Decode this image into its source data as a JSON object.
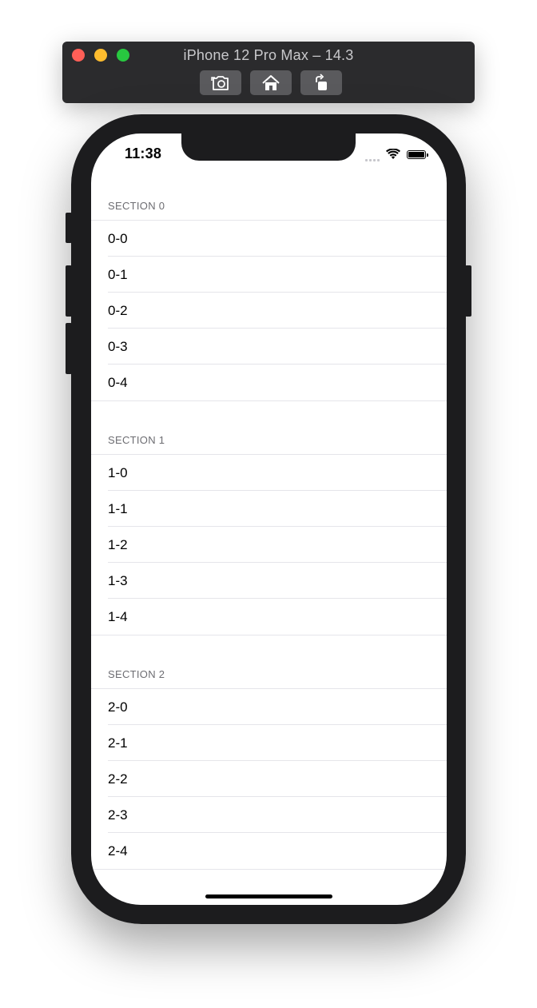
{
  "simulator": {
    "title": "iPhone 12 Pro Max – 14.3",
    "toolbar": [
      {
        "icon": "screenshot-camera-icon"
      },
      {
        "icon": "home-icon"
      },
      {
        "icon": "rotate-icon"
      }
    ]
  },
  "status_bar": {
    "time": "11:38",
    "icons": [
      "signal-dots-icon",
      "wifi-icon",
      "battery-icon"
    ]
  },
  "sections": [
    {
      "header": "SECTION 0",
      "rows": [
        "0-0",
        "0-1",
        "0-2",
        "0-3",
        "0-4"
      ]
    },
    {
      "header": "SECTION 1",
      "rows": [
        "1-0",
        "1-1",
        "1-2",
        "1-3",
        "1-4"
      ]
    },
    {
      "header": "SECTION 2",
      "rows": [
        "2-0",
        "2-1",
        "2-2",
        "2-3",
        "2-4"
      ]
    }
  ]
}
